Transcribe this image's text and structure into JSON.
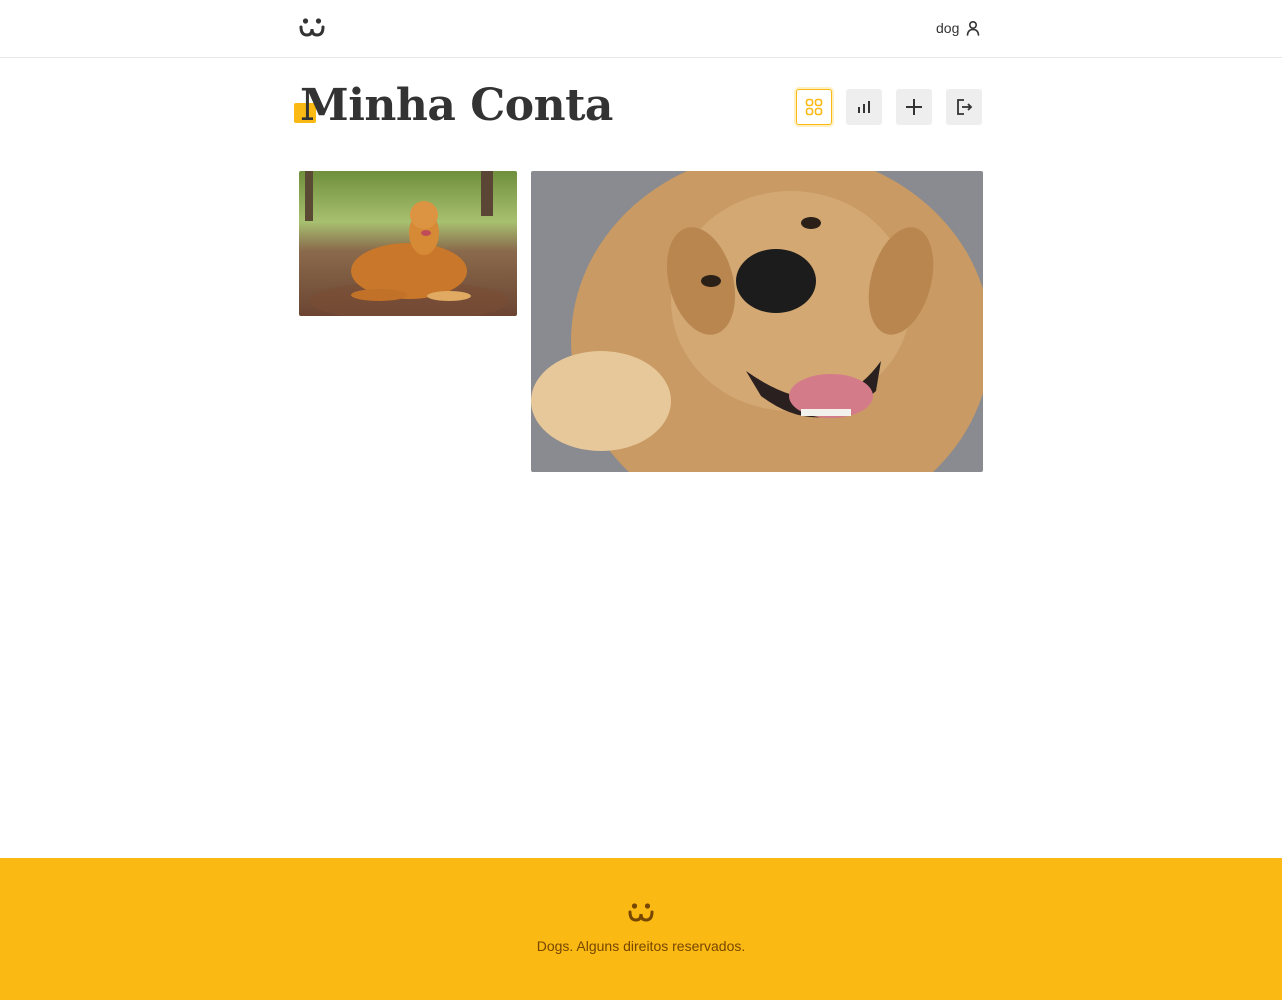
{
  "header": {
    "username": "dog",
    "icons": {
      "logo": "dog-face-logo-icon",
      "user": "user-icon"
    }
  },
  "page": {
    "title": "Minha Conta"
  },
  "toolbar": {
    "items": [
      {
        "name": "feed",
        "icon": "grid-icon",
        "active": true
      },
      {
        "name": "stats",
        "icon": "bar-chart-icon",
        "active": false
      },
      {
        "name": "post",
        "icon": "plus-icon",
        "active": false
      },
      {
        "name": "logout",
        "icon": "logout-icon",
        "active": false
      }
    ]
  },
  "feed": {
    "photos": [
      {
        "subject": "golden retriever lying on a forest trail"
      },
      {
        "subject": "golden retriever close-up smiling with open mouth"
      }
    ]
  },
  "footer": {
    "copyright": "Dogs. Alguns direitos reservados."
  },
  "colors": {
    "accent": "#fbb913",
    "footer_text": "#764701",
    "text": "#333333"
  }
}
